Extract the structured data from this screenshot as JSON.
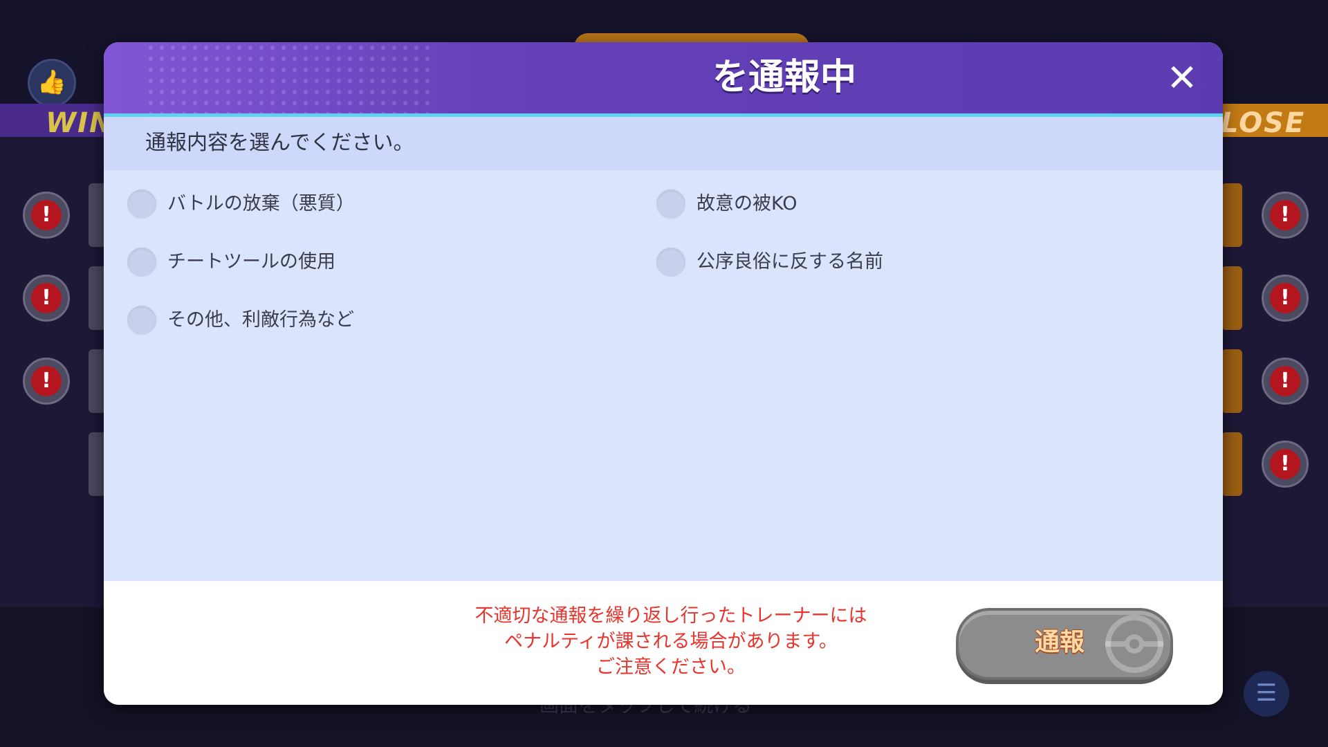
{
  "background": {
    "win_label": "WIN",
    "lose_label": "LOSE",
    "tap_hint": "画面をタップして続ける"
  },
  "dialog": {
    "title": "を通報中",
    "close_glyph": "✕",
    "instruction": "通報内容を選んでください。",
    "options": [
      {
        "label": "バトルの放棄（悪質）",
        "selected": false
      },
      {
        "label": "故意の被KO",
        "selected": false
      },
      {
        "label": "チートツールの使用",
        "selected": false
      },
      {
        "label": "公序良俗に反する名前",
        "selected": false
      },
      {
        "label": "その他、利敵行為など",
        "selected": false
      }
    ],
    "warning_lines": [
      "不適切な通報を繰り返し行ったトレーナーには",
      "ペナルティが課される場合があります。",
      "ご注意ください。"
    ],
    "submit_label": "通報",
    "submit_enabled": false
  },
  "colors": {
    "header_purple": "#6540b8",
    "accent_cyan": "#5fd2f0",
    "warning_red": "#e8342c",
    "button_gray": "#8c8c8c"
  }
}
